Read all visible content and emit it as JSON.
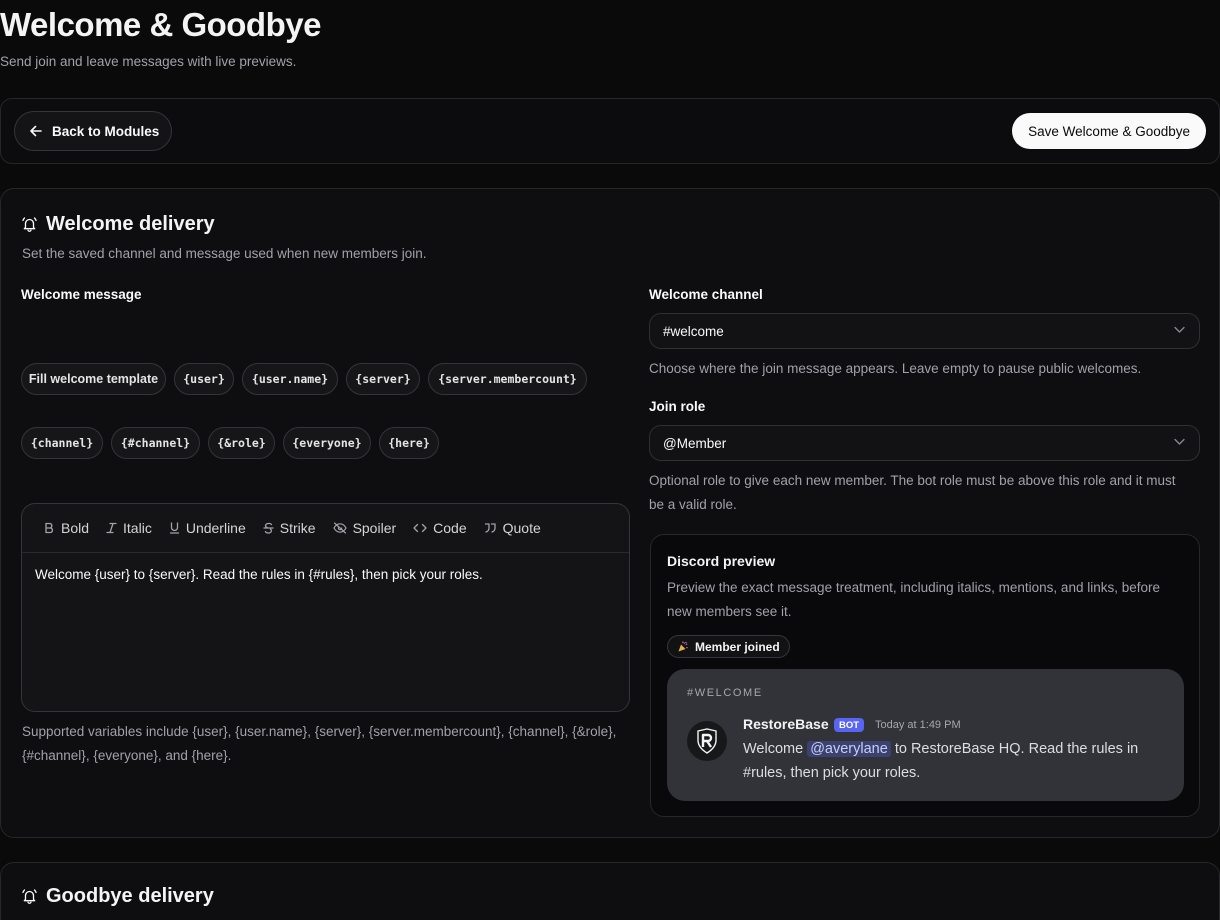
{
  "page": {
    "title": "Welcome & Goodbye",
    "subtitle": "Send join and leave messages with live previews."
  },
  "toolbar": {
    "back_label": "Back to Modules",
    "save_label": "Save Welcome & Goodbye"
  },
  "welcome": {
    "title": "Welcome delivery",
    "description": "Set the saved channel and message used when new members join.",
    "message_label": "Welcome message",
    "fill_template_label": "Fill welcome template",
    "variables": [
      "{user}",
      "{user.name}",
      "{server}",
      "{server.membercount}",
      "{channel}",
      "{#channel}",
      "{&role}",
      "{everyone}",
      "{here}"
    ],
    "format_buttons": [
      {
        "icon": "bold-icon",
        "label": "Bold"
      },
      {
        "icon": "italic-icon",
        "label": "Italic"
      },
      {
        "icon": "underline-icon",
        "label": "Underline"
      },
      {
        "icon": "strikethrough-icon",
        "label": "Strike"
      },
      {
        "icon": "spoiler-icon",
        "label": "Spoiler"
      },
      {
        "icon": "code-icon",
        "label": "Code"
      },
      {
        "icon": "quote-icon",
        "label": "Quote"
      }
    ],
    "message_text": "Welcome {user} to {server}. Read the rules in {#rules}, then pick your roles.",
    "variables_help_line1": "Supported variables include {user}, {user.name}, {server}, {server.membercount}, {channel}, {&role},",
    "variables_help_line2": "{#channel}, {everyone}, and {here}.",
    "channel_label": "Welcome channel",
    "channel_value": "#welcome",
    "channel_help": "Choose where the join message appears. Leave empty to pause public welcomes.",
    "role_label": "Join role",
    "role_value": "@Member",
    "role_help_line1": "Optional role to give each new member. The bot role must be above this role and it must",
    "role_help_line2": "be a valid role."
  },
  "preview": {
    "title": "Discord preview",
    "description": "Preview the exact message treatment, including italics, mentions, and links, before new members see it.",
    "event_badge": "Member joined",
    "channel_header": "#WELCOME",
    "bot_name": "RestoreBase",
    "bot_tag": "BOT",
    "timestamp": "Today at 1:49 PM",
    "message_prefix": "Welcome",
    "mention": "@averylane",
    "message_suffix": "to RestoreBase HQ. Read the rules in #rules, then pick your roles."
  },
  "goodbye": {
    "title": "Goodbye delivery"
  },
  "colors": {
    "background": "#0a0a0b",
    "card": "#0e0e10",
    "border": "#27272a",
    "discord_bg": "#313338",
    "bot_tag": "#5865f2",
    "mention_bg": "#3c4270"
  }
}
